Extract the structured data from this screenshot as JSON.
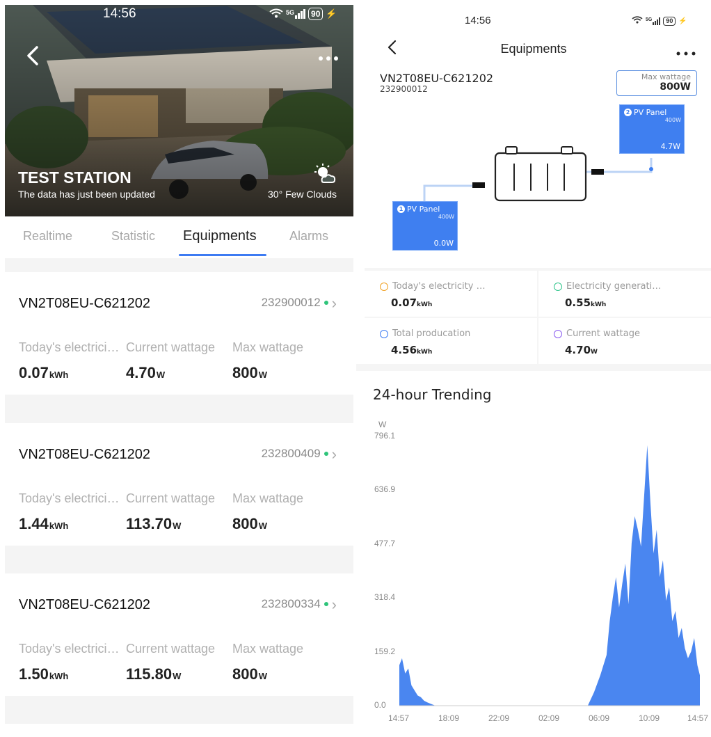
{
  "left": {
    "status_bar": {
      "time": "14:56",
      "network": "5G",
      "battery": "90"
    },
    "hero": {
      "station_name": "TEST STATION",
      "update_text": "The data has just been updated",
      "weather": "30° Few Clouds"
    },
    "tabs": [
      {
        "label": "Realtime"
      },
      {
        "label": "Statistic"
      },
      {
        "label": "Equipments"
      },
      {
        "label": "Alarms"
      }
    ],
    "active_tab": "Equipments",
    "equipments": [
      {
        "model": "VN2T08EU-C621202",
        "serial": "232900012",
        "today_label": "Today's electrici…",
        "today_value": "0.07",
        "today_unit": "kWh",
        "wattage_label": "Current wattage",
        "wattage_value": "4.70",
        "wattage_unit": "W",
        "max_label": "Max wattage",
        "max_value": "800",
        "max_unit": "W"
      },
      {
        "model": "VN2T08EU-C621202",
        "serial": "232800409",
        "today_label": "Today's electrici…",
        "today_value": "1.44",
        "today_unit": "kWh",
        "wattage_label": "Current wattage",
        "wattage_value": "113.70",
        "wattage_unit": "W",
        "max_label": "Max wattage",
        "max_value": "800",
        "max_unit": "W"
      },
      {
        "model": "VN2T08EU-C621202",
        "serial": "232800334",
        "today_label": "Today's electrici…",
        "today_value": "1.50",
        "today_unit": "kWh",
        "wattage_label": "Current wattage",
        "wattage_value": "115.80",
        "wattage_unit": "W",
        "max_label": "Max wattage",
        "max_value": "800",
        "max_unit": "W"
      }
    ]
  },
  "right": {
    "status_bar": {
      "time": "14:56",
      "network": "5G",
      "battery": "90"
    },
    "title": "Equipments",
    "device": {
      "model": "VN2T08EU-C621202",
      "serial": "232900012"
    },
    "max_wattage": {
      "label": "Max wattage",
      "value": "800W"
    },
    "panels": [
      {
        "index": "1",
        "name": "PV Panel",
        "rated": "400W",
        "value": "0.0W"
      },
      {
        "index": "2",
        "name": "PV Panel",
        "rated": "400W",
        "value": "4.7W"
      }
    ],
    "stats": [
      {
        "label": "Today's electricity …",
        "value": "0.07",
        "unit": "kWh",
        "color": "#f0a020"
      },
      {
        "label": "Electricity generati…",
        "value": "0.55",
        "unit": "kWh",
        "color": "#2ec48a"
      },
      {
        "label": "Total producation",
        "value": "4.56",
        "unit": "kWh",
        "color": "#3d7bf2"
      },
      {
        "label": "Current wattage",
        "value": "4.70",
        "unit": "W",
        "color": "#8a5cf0"
      }
    ],
    "trend_title": "24-hour Trending"
  },
  "chart_data": {
    "type": "area",
    "title": "24-hour Trending",
    "ylabel": "W",
    "yticks": [
      "796.1",
      "636.9",
      "477.7",
      "318.4",
      "159.2",
      "0.0"
    ],
    "xticks": [
      "14:57",
      "18:09",
      "22:09",
      "02:09",
      "06:09",
      "10:09",
      "14:57"
    ],
    "ylim": [
      0,
      796.1
    ],
    "color": "#4a86f0",
    "x": [
      "14:57",
      "15:10",
      "15:25",
      "15:40",
      "15:55",
      "16:10",
      "16:25",
      "16:40",
      "16:55",
      "17:10",
      "17:30",
      "17:50",
      "06:00",
      "06:30",
      "07:00",
      "07:30",
      "07:45",
      "08:00",
      "08:15",
      "08:30",
      "08:45",
      "09:00",
      "09:15",
      "09:30",
      "09:45",
      "10:00",
      "10:15",
      "10:30",
      "10:45",
      "11:00",
      "11:15",
      "11:30",
      "11:45",
      "12:00",
      "12:15",
      "12:30",
      "12:45",
      "13:00",
      "13:15",
      "13:30",
      "13:45",
      "14:00",
      "14:15",
      "14:30",
      "14:45",
      "14:57"
    ],
    "values": [
      120,
      140,
      95,
      110,
      60,
      45,
      30,
      25,
      15,
      10,
      5,
      0,
      0,
      40,
      90,
      150,
      250,
      320,
      380,
      290,
      360,
      420,
      300,
      480,
      560,
      520,
      470,
      620,
      770,
      600,
      450,
      520,
      380,
      430,
      310,
      350,
      250,
      280,
      200,
      230,
      170,
      140,
      160,
      200,
      120,
      90
    ]
  }
}
